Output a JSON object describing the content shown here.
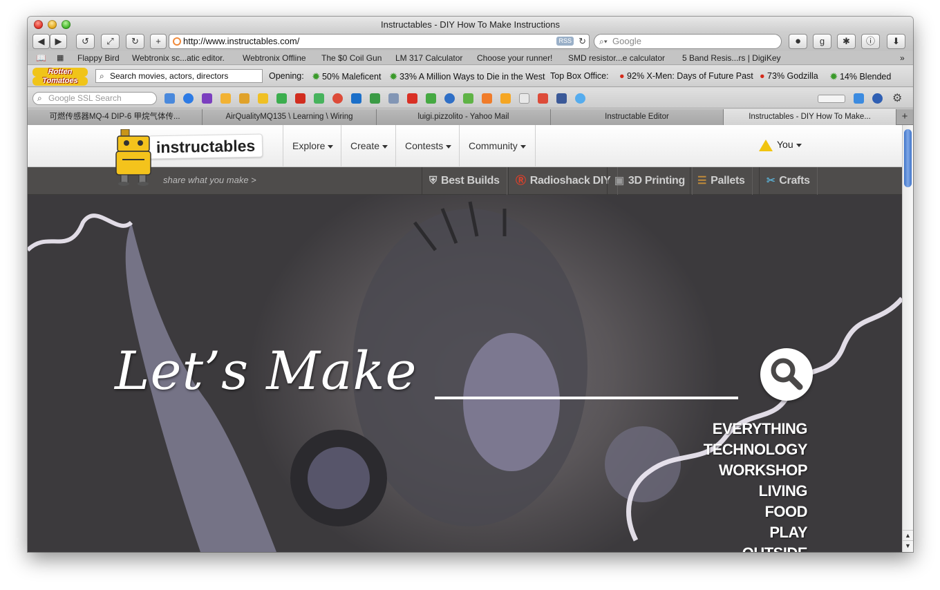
{
  "window": {
    "title": "Instructables - DIY How To Make Instructions"
  },
  "toolbar": {
    "url": "http://www.instructables.com/",
    "rss_label": "RSS",
    "search_placeholder": "Google"
  },
  "bookmarks": [
    "Flappy Bird",
    "Webtronix sc...atic editor.",
    "Webtronix Offline",
    "The $0 Coil Gun",
    "LM 317 Calculator",
    "Choose your runner!",
    "SMD resistor...e calculator",
    "5 Band Resis...rs | DigiKey"
  ],
  "rotten_tomatoes": {
    "logo_line1": "Rotten",
    "logo_line2": "Tomatoes",
    "search_placeholder": "Search movies, actors, directors",
    "opening_label": "Opening:",
    "opening": [
      "50% Maleficent",
      "33% A Million Ways to Die in the West"
    ],
    "box_office_label": "Top Box Office:",
    "box_office": [
      "92% X-Men: Days of Future Past",
      "73% Godzilla",
      "14% Blended"
    ]
  },
  "google_bar": {
    "search_placeholder": "Google SSL Search"
  },
  "tabs": [
    "可燃传感器MQ-4 DIP-6 甲烷气体传...",
    "AirQualityMQ135 \\ Learning \\ Wiring",
    "luigi.pizzolito - Yahoo Mail",
    "Instructable Editor",
    "Instructables - DIY How To Make..."
  ],
  "site": {
    "logo_text": "instructables",
    "tagline": "share what you make >",
    "nav": [
      "Explore",
      "Create",
      "Contests",
      "Community"
    ],
    "user_menu": "You",
    "channels": [
      "Best Builds",
      "Radioshack DIY",
      "3D Printing",
      "Pallets",
      "Crafts"
    ],
    "hero_title": "Let’s Make",
    "categories": [
      "EVERYTHING",
      "TECHNOLOGY",
      "WORKSHOP",
      "LIVING",
      "FOOD",
      "PLAY",
      "OUTSIDE"
    ]
  },
  "colors": {
    "accent_blue": "#3f74c9",
    "logo_yellow": "#f4c31c",
    "tomato_red": "#d42a1a",
    "splat_green": "#3a9a2a"
  }
}
